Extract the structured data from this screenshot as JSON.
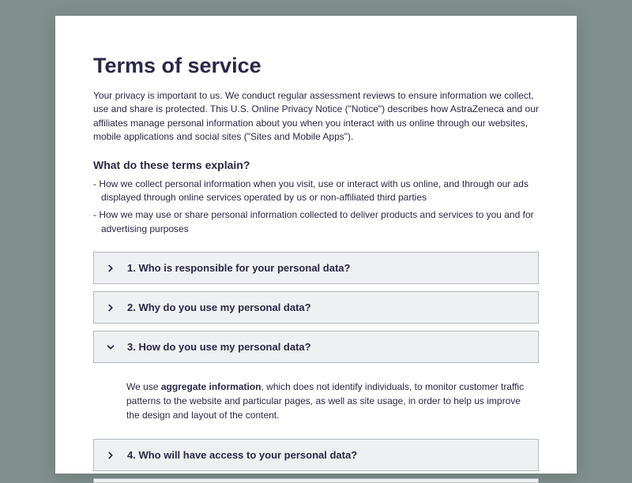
{
  "title": "Terms of service",
  "intro": "Your privacy is important to us. We conduct regular assessment reviews to ensure information we collect, use and share is protected. This U.S. Online Privacy Notice (\"Notice\") describes how AstraZeneca and our affiliates manage personal information about you when you interact with us online through our websites, mobile applications and social sites (\"Sites and Mobile Apps\").",
  "subheading": "What do these terms explain?",
  "bullets": [
    "How we collect personal information when you visit, use or interact with us online, and through our ads displayed through online services operated by us or non-affiliated third parties",
    "How we may use or share personal information collected to deliver products and services to you and for advertising purposes"
  ],
  "accordion": [
    {
      "label": "1. Who is responsible for your personal data?",
      "expanded": false
    },
    {
      "label": "2. Why do you use my personal data?",
      "expanded": false
    },
    {
      "label": "3. How do you use my personal data?",
      "expanded": true,
      "body_prefix": "We use ",
      "body_bold": "aggregate information",
      "body_suffix": ", which does not identify individuals, to monitor customer traffic patterns to the website and particular pages, as well as site usage, in order to help us improve the design and layout of the content."
    },
    {
      "label": "4. Who will have access to your personal data?",
      "expanded": false
    }
  ]
}
